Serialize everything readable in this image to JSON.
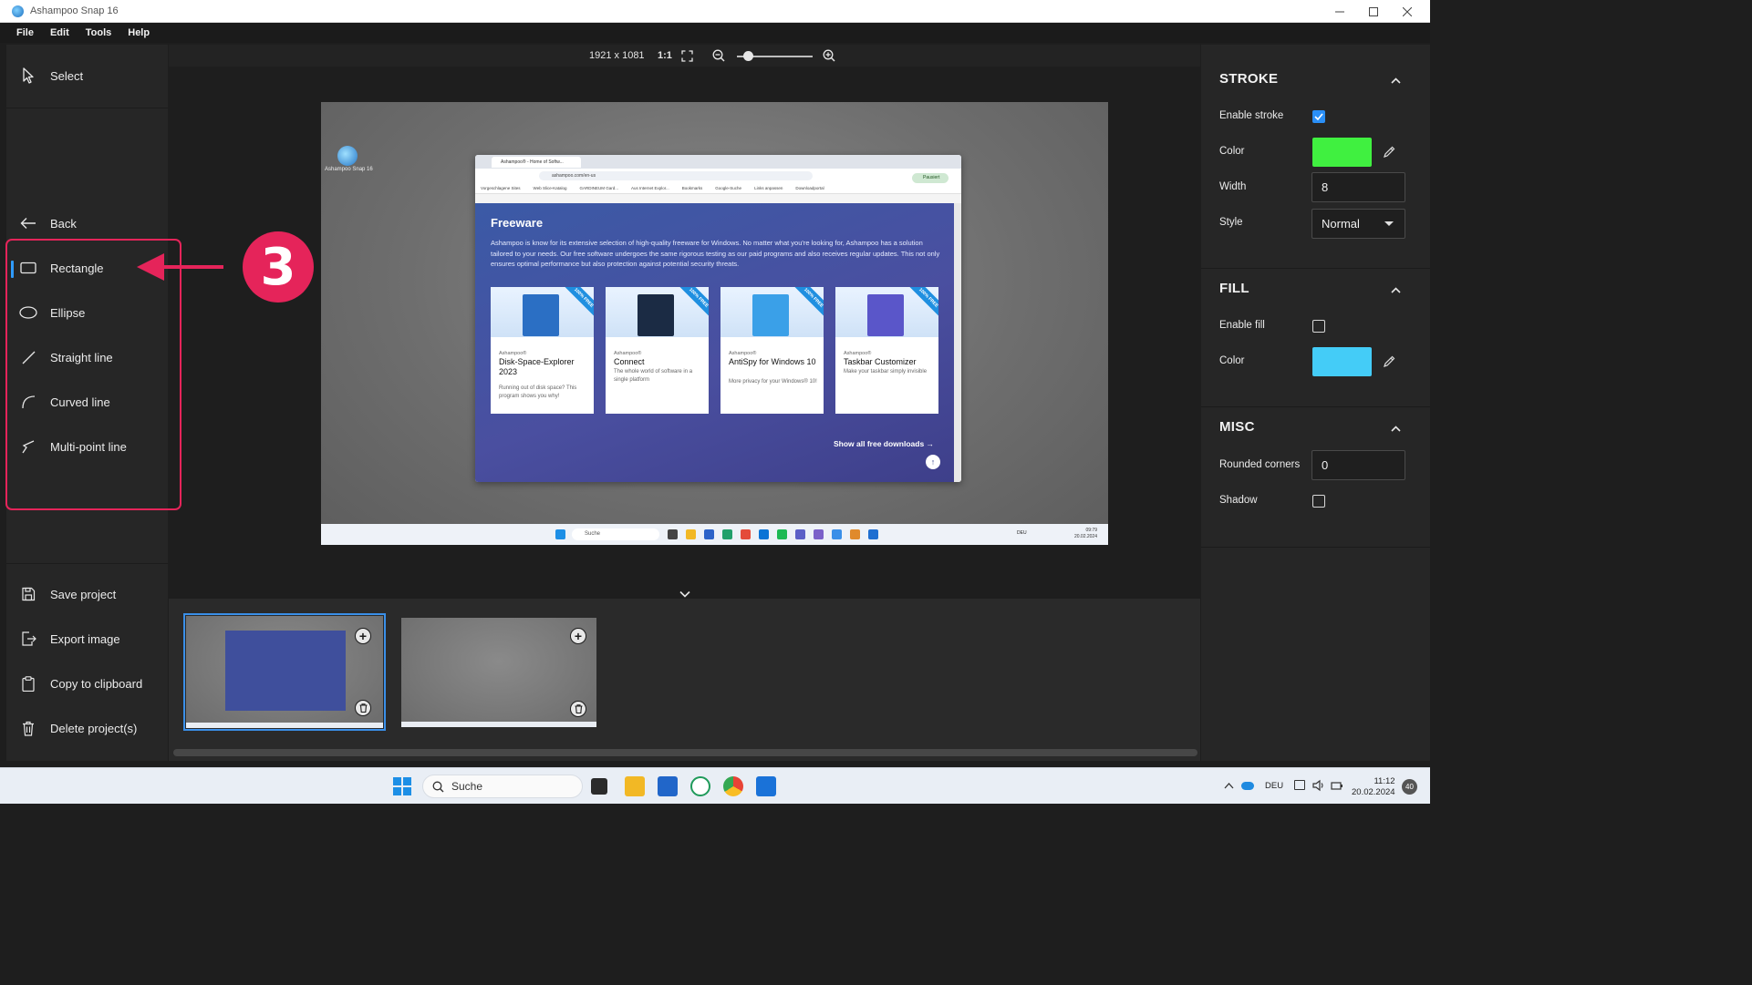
{
  "window": {
    "title": "Ashampoo Snap 16",
    "controls": [
      "minimize",
      "maximize",
      "close"
    ]
  },
  "menu": [
    "File",
    "Edit",
    "Tools",
    "Help"
  ],
  "left_panel": {
    "select_label": "Select",
    "back_label": "Back",
    "tools": [
      {
        "label": "Rectangle",
        "icon": "rectangle-icon",
        "active": true
      },
      {
        "label": "Ellipse",
        "icon": "ellipse-icon",
        "active": false
      },
      {
        "label": "Straight line",
        "icon": "straight-line-icon",
        "active": false
      },
      {
        "label": "Curved line",
        "icon": "curved-line-icon",
        "active": false
      },
      {
        "label": "Multi-point line",
        "icon": "multi-point-line-icon",
        "active": false
      }
    ],
    "actions": [
      {
        "label": "Save project",
        "icon": "save-icon"
      },
      {
        "label": "Export image",
        "icon": "export-icon"
      },
      {
        "label": "Copy to clipboard",
        "icon": "clipboard-icon"
      },
      {
        "label": "Delete project(s)",
        "icon": "trash-icon"
      }
    ]
  },
  "annotation": {
    "step_number": "3",
    "color": "#e5245a"
  },
  "zoom_bar": {
    "dimensions": "1921 x 1081",
    "ratio": "1:1",
    "zoom_level": 0.15
  },
  "preview": {
    "desktop_icon_label": "Ashampoo Snap 16",
    "browser_tab": "Ashampoo® - Home of Softw...",
    "url": "ashampoo.com/en-us",
    "profile_status": "Pausiert",
    "bookmarks": [
      "Vorgeschlagene Sites",
      "Web Slice-Katalog",
      "GARDINEUM Gard...",
      "Aus Internet Explor...",
      "Bookmarks",
      "Google-Suche",
      "Links anpassen",
      "Downloadportal"
    ],
    "section_title": "Freeware",
    "section_desc": "Ashampoo is know for its extensive selection of high-quality freeware for Windows. No matter what you're looking for, Ashampoo has a solution tailored to your needs. Our free software undergoes the same rigorous testing as our paid programs and also receives regular updates. This not only ensures optimal performance but also protection against potential security threats.",
    "cards": [
      {
        "brand": "Ashampoo®",
        "name": "Disk-Space-Explorer 2023",
        "desc": "Running out of disk space? This program shows you why!",
        "badge": "100% FREE",
        "color": "#2b6fc4"
      },
      {
        "brand": "Ashampoo®",
        "name": "Connect",
        "desc": "The whole world of software in a single platform",
        "badge": "100% FREE",
        "color": "#1b2b44"
      },
      {
        "brand": "Ashampoo®",
        "name": "AntiSpy for Windows 10",
        "desc": "More privacy for your Windows® 10!",
        "badge": "100% FREE",
        "color": "#3aa0e8"
      },
      {
        "brand": "Ashampoo®",
        "name": "Taskbar Customizer",
        "desc": "Make your taskbar simply invisible",
        "badge": "100% FREE",
        "color": "#5a56c9"
      }
    ],
    "show_all": "Show all free downloads →",
    "mini_search": "Suche",
    "mini_lang": "DEU",
    "mini_time": "09:79",
    "mini_date": "20.02.2024"
  },
  "right_panel": {
    "stroke": {
      "title": "STROKE",
      "enable_label": "Enable stroke",
      "enabled": true,
      "color_label": "Color",
      "color": "#40f040",
      "width_label": "Width",
      "width_value": "8",
      "style_label": "Style",
      "style_value": "Normal"
    },
    "fill": {
      "title": "FILL",
      "enable_label": "Enable fill",
      "enabled": false,
      "color_label": "Color",
      "color": "#44ccf7"
    },
    "misc": {
      "title": "MISC",
      "rounded_label": "Rounded corners",
      "rounded_value": "0",
      "shadow_label": "Shadow",
      "shadow": false
    }
  },
  "taskbar": {
    "search_label": "Suche",
    "language": "DEU",
    "time": "11:12",
    "date": "20.02.2024",
    "notifications": "40"
  },
  "colors": {
    "accent": "#2f9bff",
    "panel_bg": "#262626",
    "canvas_bg": "#1e1e1e"
  }
}
